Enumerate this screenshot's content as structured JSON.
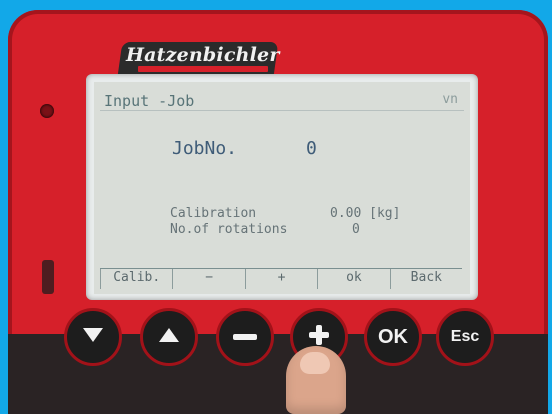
{
  "device": {
    "brand": "Hatzenbichler"
  },
  "screen": {
    "title": "Input -Job",
    "title_right": "vn",
    "job_label": "JobNo.",
    "job_value": "0",
    "calibration_label": "Calibration",
    "calibration_value": "0.00 [kg]",
    "rotations_label": "No.of rotations",
    "rotations_value": "0",
    "softkeys": [
      "Calib.",
      "−",
      "+",
      "ok",
      "Back"
    ]
  },
  "buttons": {
    "down_icon": "triangle-down",
    "up_icon": "triangle-up",
    "minus_icon": "minus",
    "plus_icon": "plus",
    "ok_label": "OK",
    "esc_label": "Esc"
  }
}
